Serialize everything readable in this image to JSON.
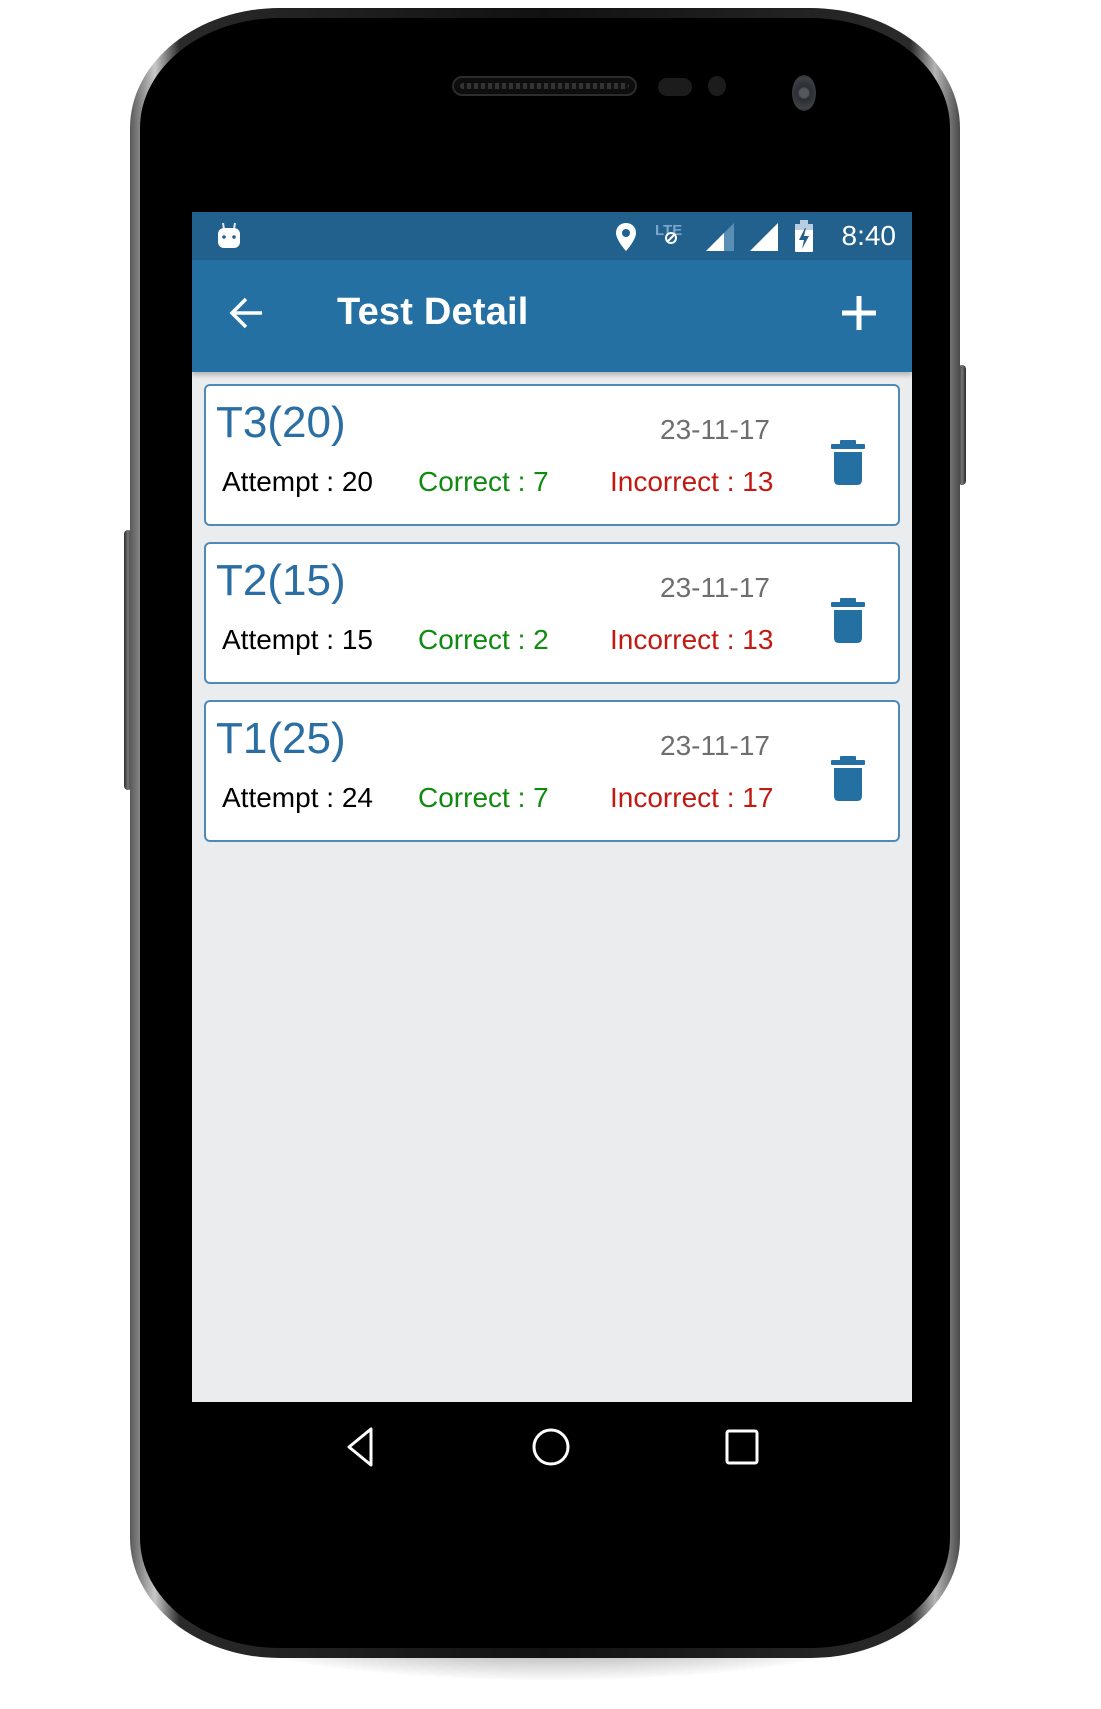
{
  "status_bar": {
    "time": "8:40",
    "icons": [
      "android-notification-icon",
      "location-icon",
      "lte-no-data-icon",
      "signal-icon",
      "signal-full-icon",
      "battery-charging-icon"
    ]
  },
  "app_bar": {
    "title": "Test Detail",
    "back_icon": "arrow-left-icon",
    "add_icon": "plus-icon"
  },
  "tests": [
    {
      "name": "T3(20)",
      "date": "23-11-17",
      "attempt_label": "Attempt : 20",
      "correct_label": "Correct : 7",
      "incorrect_label": "Incorrect : 13",
      "attempt": 20,
      "correct": 7,
      "incorrect": 13
    },
    {
      "name": "T2(15)",
      "date": "23-11-17",
      "attempt_label": "Attempt : 15",
      "correct_label": "Correct : 2",
      "incorrect_label": "Incorrect : 13",
      "attempt": 15,
      "correct": 2,
      "incorrect": 13
    },
    {
      "name": "T1(25)",
      "date": "23-11-17",
      "attempt_label": "Attempt : 24",
      "correct_label": "Correct : 7",
      "incorrect_label": "Incorrect : 17",
      "attempt": 24,
      "correct": 7,
      "incorrect": 17
    }
  ],
  "nav_bar": {
    "buttons": [
      "back-triangle-icon",
      "home-circle-icon",
      "recents-square-icon"
    ]
  },
  "colors": {
    "primary": "#2470a3",
    "primary_dark": "#22618e",
    "title_text": "#2a6ea3",
    "correct": "#118a11",
    "incorrect": "#c11a12",
    "date": "#6e6e6e",
    "background": "#ebecee"
  }
}
